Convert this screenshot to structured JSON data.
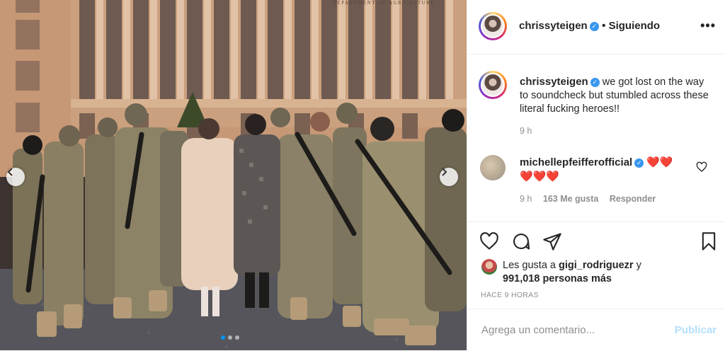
{
  "post": {
    "author": "chrissyteigen",
    "follow_state": "Siguiendo",
    "more_label": "•••",
    "caption": "we got lost on the way to soundcheck but stumbled across these literal fucking heroes!!",
    "caption_time": "9 h"
  },
  "comment": {
    "author": "michellepfeifferofficial",
    "emojis_line1": "❤️❤️",
    "emojis_line2": "❤️❤️❤️",
    "time": "9 h",
    "likes": "163 Me gusta",
    "reply_label": "Responder"
  },
  "likes": {
    "prefix": "Les gusta a",
    "user": "gigi_rodriguezr",
    "conjunction": "y",
    "count": "991,018 personas más"
  },
  "timestamp": "HACE 9 HORAS",
  "add_comment": {
    "placeholder": "Agrega un comentario...",
    "publish_label": "Publicar"
  },
  "photo_sign": "DEPARTMENT OF AGRICULTURE",
  "carousel": {
    "count": 3,
    "active": 0
  },
  "colors": {
    "accent": "#0095f6",
    "verified": "#3897f0",
    "publish_disabled": "#b2dffc",
    "heart": "#e0244a"
  },
  "icons": [
    "verified-icon",
    "heart-icon",
    "comment-icon",
    "share-icon",
    "bookmark-icon",
    "chevron-left-icon",
    "chevron-right-icon"
  ]
}
